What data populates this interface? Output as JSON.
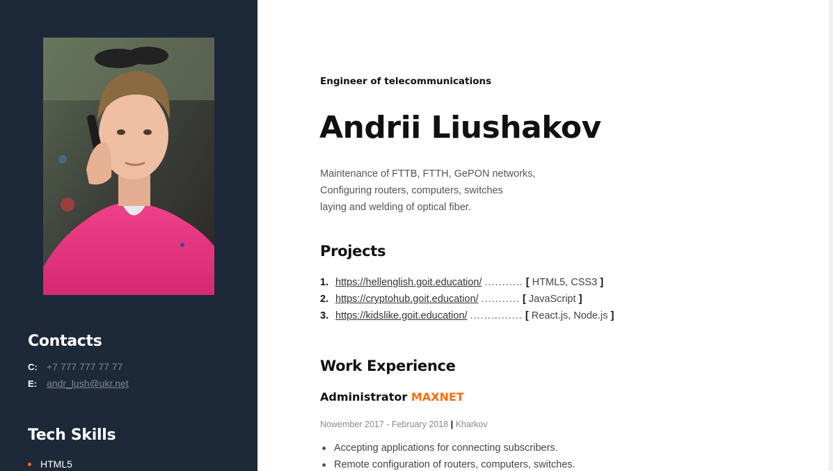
{
  "sidebar": {
    "contacts_heading": "Contacts",
    "contacts": [
      {
        "label": "C:",
        "value": "+7 777 777 77 77"
      },
      {
        "label": "E:",
        "value": "andr_lush@ukr.net"
      }
    ],
    "skills_heading": "Tech Skills",
    "skills": [
      "HTML5"
    ]
  },
  "main": {
    "subtitle": "Engineer of telecommunications",
    "name": "Andrii Liushakov",
    "description": [
      "Maintenance of FTTB, FTTH, GePON networks,",
      "Configuring routers, computers, switches",
      "laying and welding of optical fiber."
    ],
    "projects_heading": "Projects",
    "projects": [
      {
        "num": "1.",
        "url": "https://hellenglish.goit.education/",
        "dots": "...........",
        "tech": "HTML5, CSS3"
      },
      {
        "num": "2.",
        "url": "https://cryptohub.goit.education/",
        "dots": "...........",
        "tech": "JavaScript"
      },
      {
        "num": "3.",
        "url": "https://kidslike.goit.education/",
        "dots": "...............",
        "tech": "React.js, Node.js"
      }
    ],
    "work_heading": "Work Experience",
    "job": {
      "role": "Administrator",
      "company": "MAXNET",
      "period": "Nowember 2017 - February 2018",
      "separator": "|",
      "location": "Kharkov",
      "duties": [
        "Accepting applications for connecting subscribers.",
        "Remote configuration of routers, computers, switches."
      ]
    }
  },
  "colors": {
    "sidebar_bg": "#1d2838",
    "accent": "#ff6b08",
    "muted_text": "#7f8794"
  }
}
